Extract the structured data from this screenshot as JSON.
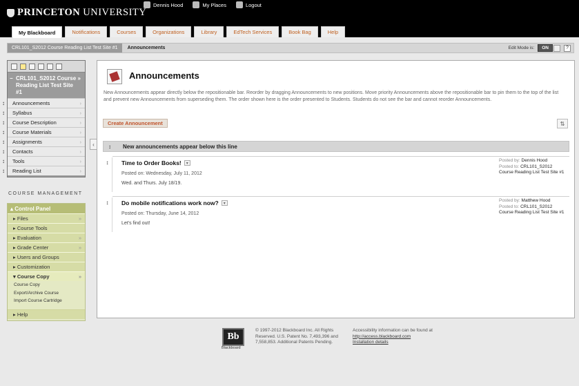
{
  "header": {
    "logo_bold": "PRINCETON",
    "logo_rest": "UNIVERSITY",
    "user": "Dennis Hood",
    "my_places": "My Places",
    "logout": "Logout"
  },
  "tabs": [
    {
      "label": "My Blackboard",
      "active": true
    },
    {
      "label": "Notifications"
    },
    {
      "label": "Courses"
    },
    {
      "label": "Organizations"
    },
    {
      "label": "Library"
    },
    {
      "label": "EdTech Services"
    },
    {
      "label": "Book Bag"
    },
    {
      "label": "Help"
    }
  ],
  "breadcrumb": {
    "course": "CRL101_S2012 Course Reading List Test Site #1",
    "page": "Announcements"
  },
  "edit_mode": {
    "label": "Edit Mode is:",
    "state": "ON",
    "help": "?"
  },
  "course_menu": {
    "title": "CRL101_S2012 Course Reading List Test Site #1",
    "items": [
      "Announcements",
      "Syllabus",
      "Course Description",
      "Course Materials",
      "Assignments",
      "Contacts",
      "Tools",
      "Reading List"
    ]
  },
  "course_management": {
    "heading": "COURSE MANAGEMENT",
    "control_panel": "Control Panel",
    "items": [
      "Files",
      "Course Tools",
      "Evaluation",
      "Grade Center",
      "Users and Groups",
      "Customization"
    ],
    "open_item": "Course Copy",
    "sub_items": [
      "Course Copy",
      "Export/Archive Course",
      "Import Course Cartridge"
    ],
    "help": "Help"
  },
  "main": {
    "title": "Announcements",
    "description": "New Announcements appear directly below the repositionable bar. Reorder by dragging Announcements to new positions. Move priority Announcements above the repositionable bar to pin them to the top of the list and prevent new Announcements from superseding them. The order shown here is the order presented to Students. Students do not see the bar and cannot reorder Announcements.",
    "create_button": "Create Announcement",
    "bar_text": "New announcements appear below this line",
    "announcements": [
      {
        "title": "Time to Order Books!",
        "posted": "Posted on: Wednesday, July 11, 2012",
        "body": "Wed. and Thurs. July 18/19.",
        "posted_by_label": "Posted by:",
        "posted_by": "Dennis Hood",
        "posted_to_label": "Posted to:",
        "posted_to": "CRL101_S2012 Course Reading List Test Site #1"
      },
      {
        "title": "Do mobile notifications work now?",
        "posted": "Posted on: Thursday, June 14, 2012",
        "body": "Let's find out!",
        "posted_by_label": "Posted by:",
        "posted_by": "Matthew Hood",
        "posted_to_label": "Posted to:",
        "posted_to": "CRL101_S2012 Course Reading List Test Site #1"
      }
    ]
  },
  "footer": {
    "logo": "Bb",
    "logo_text": "Blackboard",
    "copyright": "© 1997-2012 Blackboard Inc. All Rights Reserved. U.S. Patent No. 7,493,396 and 7,558,853. Additional Patents Pending.",
    "accessibility": "Accessibility information can be found at",
    "access_link": "http://access.blackboard.com",
    "install_link": "Installation details"
  },
  "colors": {
    "accent": "#c06020",
    "panel": "#b6bd76",
    "menu": "#9b9b9b"
  }
}
